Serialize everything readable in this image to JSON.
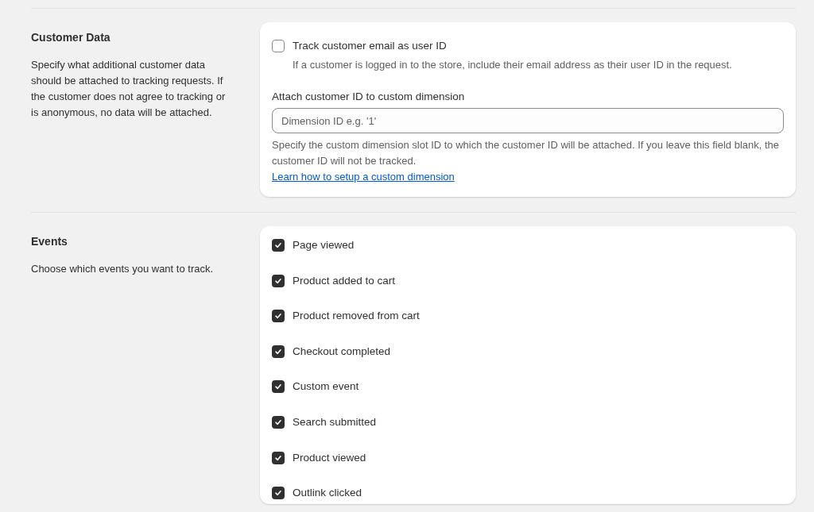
{
  "sections": [
    {
      "kind": "customer",
      "heading": "Customer Data",
      "description": "Specify what additional customer data should be attached to tracking requests. If the customer does not agree to tracking or is anonymous, no data will be attached.",
      "email_option": {
        "label": "Track customer email as user ID",
        "help": "If a customer is logged in to the store, include their email address as their user ID in the request.",
        "checked": false
      },
      "dimension_field": {
        "label": "Attach customer ID to custom dimension",
        "placeholder": "Dimension ID e.g. '1'",
        "help": "Specify the custom dimension slot ID to which the customer ID will be attached. If you leave this field blank, the customer ID will not be tracked.",
        "link": "Learn how to setup a custom dimension"
      }
    },
    {
      "kind": "events",
      "heading": "Events",
      "description": "Choose which events you want to track.",
      "events": [
        {
          "label": "Page viewed",
          "checked": true
        },
        {
          "label": "Product added to cart",
          "checked": true
        },
        {
          "label": "Product removed from cart",
          "checked": true
        },
        {
          "label": "Checkout completed",
          "checked": true
        },
        {
          "label": "Custom event",
          "checked": true
        },
        {
          "label": "Search submitted",
          "checked": true
        },
        {
          "label": "Product viewed",
          "checked": true
        },
        {
          "label": "Outlink clicked",
          "checked": true
        }
      ]
    }
  ]
}
